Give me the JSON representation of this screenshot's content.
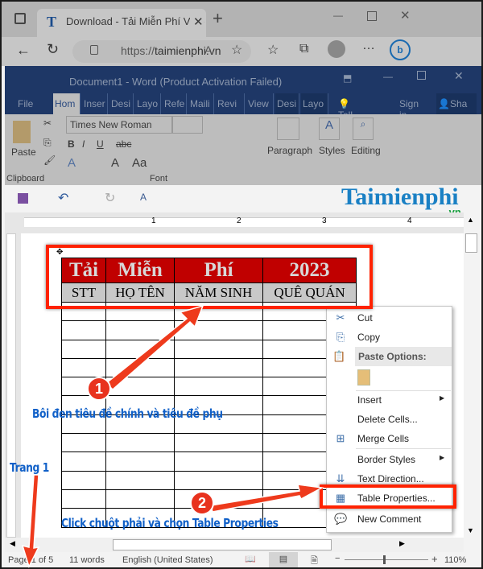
{
  "browser": {
    "tab_title": "Download - Tải Miễn Phí VN - Ph",
    "url_prefix": "https://",
    "url_host": "taimienphi.vn"
  },
  "word": {
    "title": "Document1 - Word (Product Activation Failed)",
    "tabs": [
      "File",
      "Hom",
      "Inser",
      "Desi",
      "Layo",
      "Refe",
      "Maili",
      "Revi",
      "View",
      "Desi",
      "Layo"
    ],
    "tell_me": "Tell me...",
    "sign_in": "Sign in",
    "share": "Sha",
    "font_name": "Times New Roman",
    "paste": "Paste",
    "paragraph": "Paragraph",
    "styles": "Styles",
    "editing": "Editing",
    "group_clipboard": "Clipboard",
    "group_font": "Font"
  },
  "logo": {
    "text": "Taimienphi",
    "suffix": ".vn"
  },
  "ruler_numbers": [
    "1",
    "2",
    "3",
    "4"
  ],
  "table": {
    "title_row": [
      "Tải",
      "Miễn",
      "Phí",
      "2023"
    ],
    "header_row": [
      "STT",
      "HỌ TÊN",
      "NĂM SINH",
      "QUÊ QUÁN"
    ],
    "empty_rows": 12
  },
  "context_menu": {
    "cut": "Cut",
    "copy": "Copy",
    "paste_options": "Paste Options:",
    "insert": "Insert",
    "delete_cells": "Delete Cells...",
    "merge_cells": "Merge Cells",
    "border_styles": "Border Styles",
    "text_direction": "Text Direction...",
    "table_properties": "Table Properties...",
    "new_comment": "New Comment"
  },
  "annotations": {
    "step1": "1",
    "step1_text": "Bôi đen tiêu đề chính và tiêu đề phụ",
    "step2": "2",
    "step2_text": "Click chuột phải và chọn Table Properties",
    "page_label": "Trang 1"
  },
  "status": {
    "page": "Page 1 of 5",
    "words": "11 words",
    "language": "English (United States)",
    "zoom": "110%",
    "zoom_level_percent": 110
  },
  "colors": {
    "accent_red": "#ff2200",
    "title_row": "#c00000",
    "caption_blue": "#1060c8",
    "word_blue": "#1e3766"
  }
}
